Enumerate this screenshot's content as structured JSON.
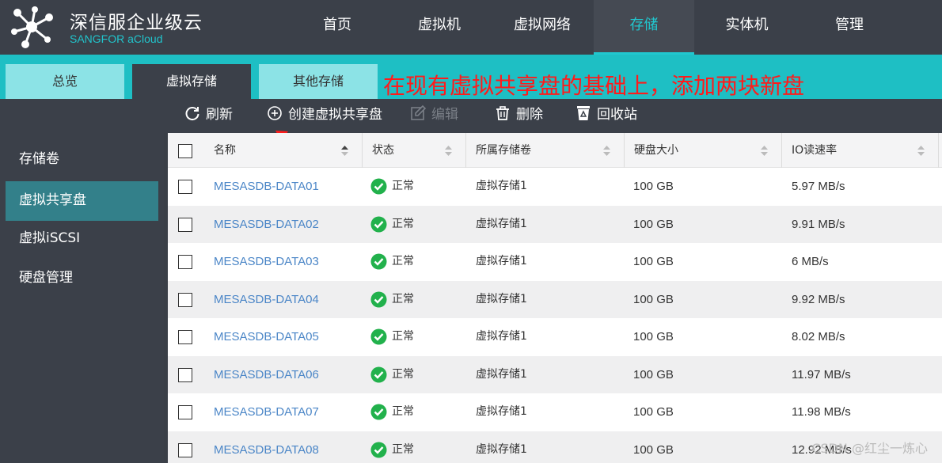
{
  "header": {
    "brand_cn": "深信服企业级云",
    "brand_en": "SANGFOR aCloud",
    "nav": [
      "首页",
      "虚拟机",
      "虚拟网络",
      "存储",
      "实体机",
      "管理"
    ],
    "active_nav": "存储"
  },
  "subtabs": [
    "总览",
    "虚拟存储",
    "其他存储"
  ],
  "active_subtab": "虚拟存储",
  "annotation": "在现有虚拟共享盘的基础上，添加两块新盘",
  "toolbar": {
    "refresh": "刷新",
    "create": "创建虚拟共享盘",
    "edit": "编辑",
    "delete": "删除",
    "recycle": "回收站"
  },
  "sidebar": [
    "存储卷",
    "虚拟共享盘",
    "虚拟iSCSI",
    "硬盘管理"
  ],
  "active_sidebar": "虚拟共享盘",
  "table": {
    "columns": [
      "名称",
      "状态",
      "所属存储卷",
      "硬盘大小",
      "IO读速率"
    ],
    "rows": [
      {
        "name": "MESASDB-DATA01",
        "status": "正常",
        "volume": "虚拟存储1",
        "size": "100 GB",
        "io": "5.97 MB/s"
      },
      {
        "name": "MESASDB-DATA02",
        "status": "正常",
        "volume": "虚拟存储1",
        "size": "100 GB",
        "io": "9.91 MB/s"
      },
      {
        "name": "MESASDB-DATA03",
        "status": "正常",
        "volume": "虚拟存储1",
        "size": "100 GB",
        "io": "6 MB/s"
      },
      {
        "name": "MESASDB-DATA04",
        "status": "正常",
        "volume": "虚拟存储1",
        "size": "100 GB",
        "io": "9.92 MB/s"
      },
      {
        "name": "MESASDB-DATA05",
        "status": "正常",
        "volume": "虚拟存储1",
        "size": "100 GB",
        "io": "8.02 MB/s"
      },
      {
        "name": "MESASDB-DATA06",
        "status": "正常",
        "volume": "虚拟存储1",
        "size": "100 GB",
        "io": "11.97 MB/s"
      },
      {
        "name": "MESASDB-DATA07",
        "status": "正常",
        "volume": "虚拟存储1",
        "size": "100 GB",
        "io": "11.98 MB/s"
      },
      {
        "name": "MESASDB-DATA08",
        "status": "正常",
        "volume": "虚拟存储1",
        "size": "100 GB",
        "io": "12.92 MB/s"
      }
    ]
  },
  "watermark": "CSDN @红尘一炼心",
  "colors": {
    "accent": "#21c7cf",
    "annotation": "#ff1b1b",
    "link": "#4b86c7",
    "ok": "#22b14c"
  }
}
